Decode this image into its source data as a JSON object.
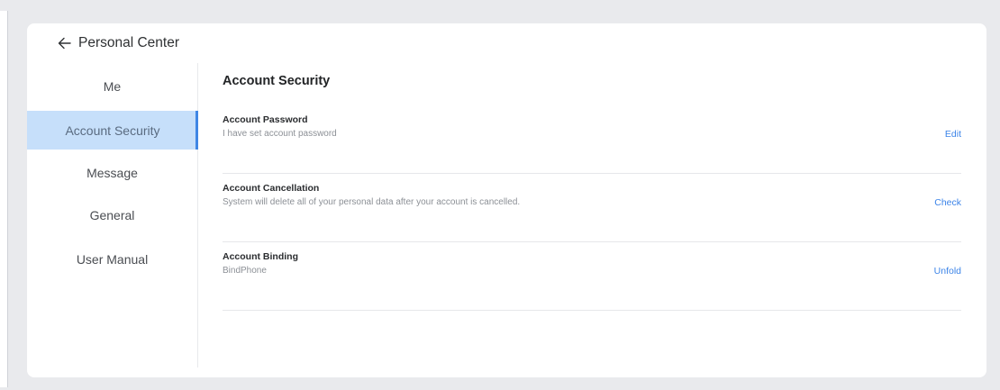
{
  "header": {
    "back_label": "Personal Center"
  },
  "sidebar": {
    "items": [
      {
        "label": "Me"
      },
      {
        "label": "Account Security"
      },
      {
        "label": "Message"
      },
      {
        "label": "General"
      },
      {
        "label": "User Manual"
      }
    ],
    "active": "Account Security"
  },
  "main": {
    "title": "Account Security",
    "rows": [
      {
        "title": "Account Password",
        "description": "I have set account password",
        "action": "Edit"
      },
      {
        "title": "Account Cancellation",
        "description": "System will delete all of your personal data after your account is cancelled.",
        "action": "Check"
      },
      {
        "title": "Account Binding",
        "description": "BindPhone",
        "action": "Unfold"
      }
    ]
  },
  "colors": {
    "accent": "#3c84e8",
    "active_bg": "#c6dffa",
    "page_bg": "#e9eaed"
  },
  "icons": {
    "back": "arrow-left-icon"
  }
}
